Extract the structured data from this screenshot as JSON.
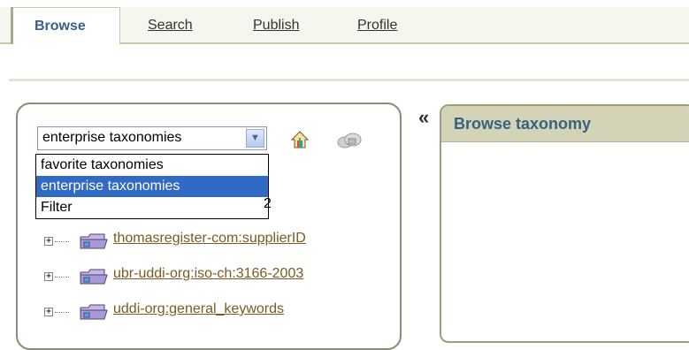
{
  "tabs": [
    {
      "label": "Browse",
      "active": true
    },
    {
      "label": "Search",
      "active": false
    },
    {
      "label": "Publish",
      "active": false
    },
    {
      "label": "Profile",
      "active": false
    }
  ],
  "taxonomy_select": {
    "selected": "enterprise taxonomies",
    "options": [
      "favorite taxonomies",
      "enterprise taxonomies",
      "Filter"
    ]
  },
  "partial_text": "2",
  "tree_items": [
    {
      "label": "thomasregister-com:supplierID"
    },
    {
      "label": "ubr-uddi-org:iso-ch:3166-2003"
    },
    {
      "label": "uddi-org:general_keywords"
    }
  ],
  "collapse_label": "«",
  "right_panel": {
    "title": "Browse taxonomy"
  },
  "colors": {
    "active_tab": "#3a5f8a",
    "link": "#7a5a25",
    "panel_header": "#d3d3b8",
    "selection": "#316ac5"
  }
}
